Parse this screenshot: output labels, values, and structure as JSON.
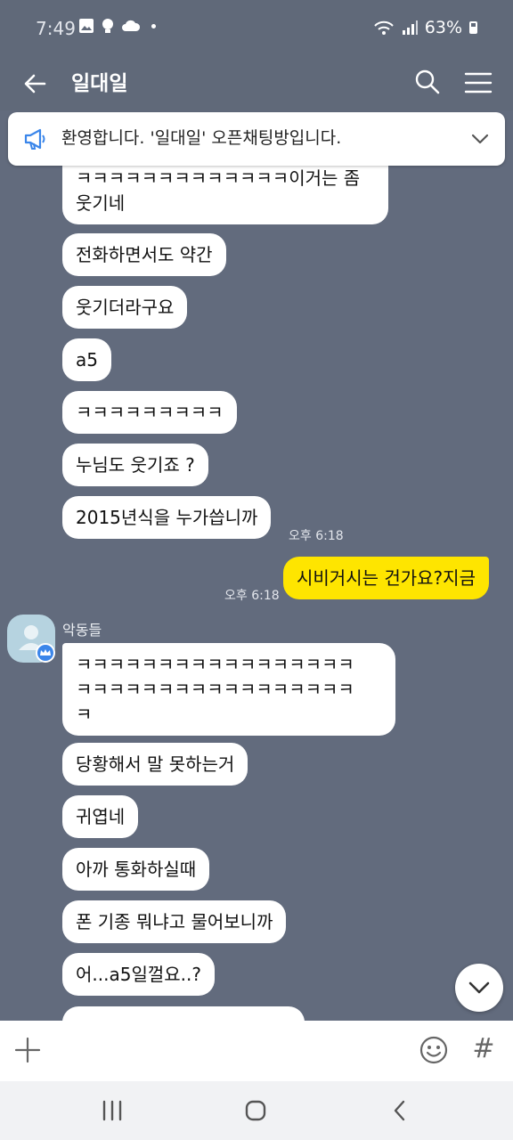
{
  "status_bar": {
    "time": "7:49",
    "battery": "63%"
  },
  "header": {
    "title": "일대일"
  },
  "notice": {
    "text": "환영합니다. '일대일' 오픈채팅방입니다."
  },
  "chat": {
    "incoming_1": [
      "ㅋㅋㅋㅋㅋㅋㅋㅋㅋㅋㅋㅋㅋ이거는 좀",
      "웃기네",
      "전화하면서도 약간",
      "웃기더라구요",
      "a5",
      "ㅋㅋㅋㅋㅋㅋㅋㅋㅋ",
      "누님도 웃기죠 ?",
      "2015년식을 누가씁니까"
    ],
    "incoming_1_time": "오후 6:18",
    "outgoing": {
      "text": "시비거시는 건가요?지금",
      "time": "오후 6:18"
    },
    "sender": {
      "name": "악동들"
    },
    "incoming_2": [
      "ㅋㅋㅋㅋㅋㅋㅋㅋㅋㅋㅋㅋㅋㅋㅋㅋㅋ",
      "ㅋㅋㅋㅋㅋㅋㅋㅋㅋㅋㅋㅋㅋㅋㅋㅋㅋ",
      "ㅋ",
      "당황해서 말 못하는거",
      "귀엽네",
      "아까 통화하실때",
      "폰 기종 뭐냐고 물어보니까",
      "어...a5일껄요..?"
    ]
  },
  "input_bar": {
    "hash": "#"
  },
  "colors": {
    "background": "#626b7d",
    "my_bubble": "#fee500",
    "other_bubble": "#ffffff",
    "badge": "#3b86ea"
  },
  "icons": [
    "back-arrow-icon",
    "search-icon",
    "hamburger-menu-icon",
    "megaphone-icon",
    "chevron-down-icon",
    "avatar-icon",
    "crown-icon",
    "plus-icon",
    "emoji-icon",
    "hash-icon"
  ]
}
